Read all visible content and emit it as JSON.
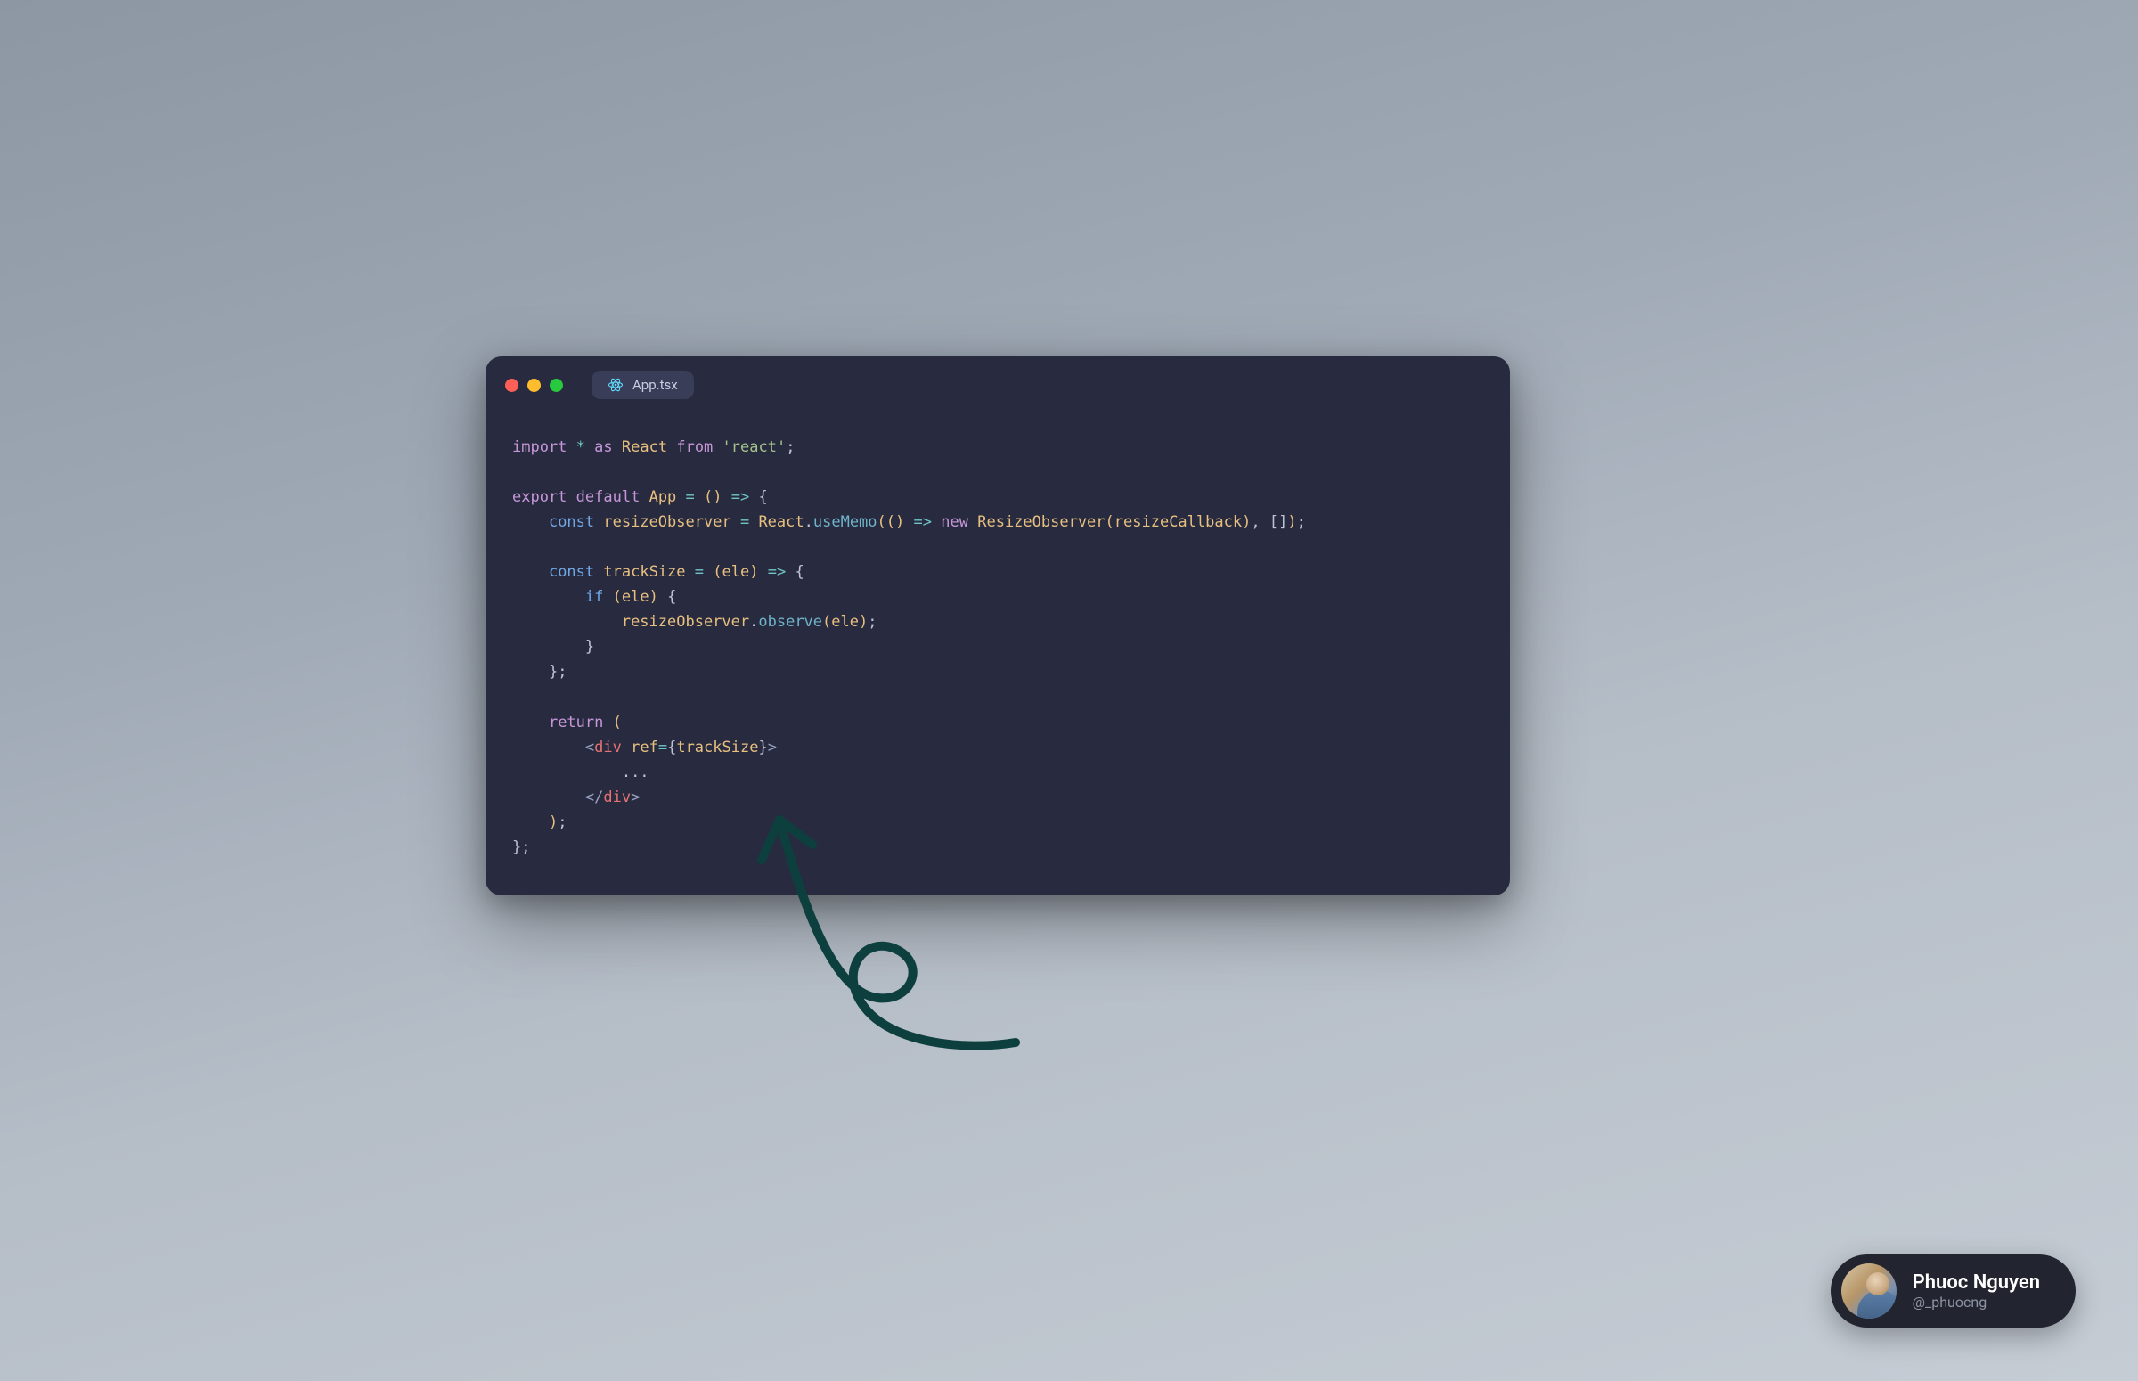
{
  "window": {
    "tab_label": "App.tsx",
    "tab_icon_name": "react-icon"
  },
  "code": {
    "l1": {
      "import": "import",
      "star": "*",
      "as": "as",
      "react": "React",
      "from": "from",
      "pkg": "'react'",
      "semi": ";"
    },
    "l3": {
      "export": "export",
      "default": "default",
      "app": "App",
      "eq": "=",
      "lp": "(",
      "rp": ")",
      "arrow": "=>",
      "lb": "{"
    },
    "l4": {
      "const": "const",
      "name": "resizeObserver",
      "eq": "=",
      "react": "React",
      "dot": ".",
      "useMemo": "useMemo",
      "lp1": "(",
      "lp2": "(",
      "rp2": ")",
      "arrow": "=>",
      "new": "new",
      "ctor": "ResizeObserver",
      "lp3": "(",
      "arg": "resizeCallback",
      "rp3": ")",
      "comma": ",",
      "lbkt": "[",
      "rbkt": "]",
      "rp1": ")",
      "semi": ";"
    },
    "l6": {
      "const": "const",
      "name": "trackSize",
      "eq": "=",
      "lp": "(",
      "arg": "ele",
      "rp": ")",
      "arrow": "=>",
      "lb": "{"
    },
    "l7": {
      "if": "if",
      "lp": "(",
      "cond": "ele",
      "rp": ")",
      "lb": "{"
    },
    "l8": {
      "obj": "resizeObserver",
      "dot": ".",
      "method": "observe",
      "lp": "(",
      "arg": "ele",
      "rp": ")",
      "semi": ";"
    },
    "l9": {
      "rb": "}"
    },
    "l10": {
      "rb": "}",
      "semi": ";"
    },
    "l12": {
      "return": "return",
      "lp": "("
    },
    "l13": {
      "open": "<",
      "tag": "div",
      "sp": " ",
      "attr": "ref",
      "eq": "=",
      "lb": "{",
      "val": "trackSize",
      "rb": "}",
      "close": ">"
    },
    "l14": {
      "dots": "..."
    },
    "l15": {
      "open": "</",
      "tag": "div",
      "close": ">"
    },
    "l16": {
      "rp": ")",
      "semi": ";"
    },
    "l17": {
      "rb": "}",
      "semi": ";"
    }
  },
  "author": {
    "name": "Phuoc Nguyen",
    "handle": "@_phuocng"
  },
  "colors": {
    "window_bg": "#282a3f",
    "tab_bg": "#3a3d57",
    "author_bg": "#22252f",
    "arrow": "#0d3f3f"
  }
}
